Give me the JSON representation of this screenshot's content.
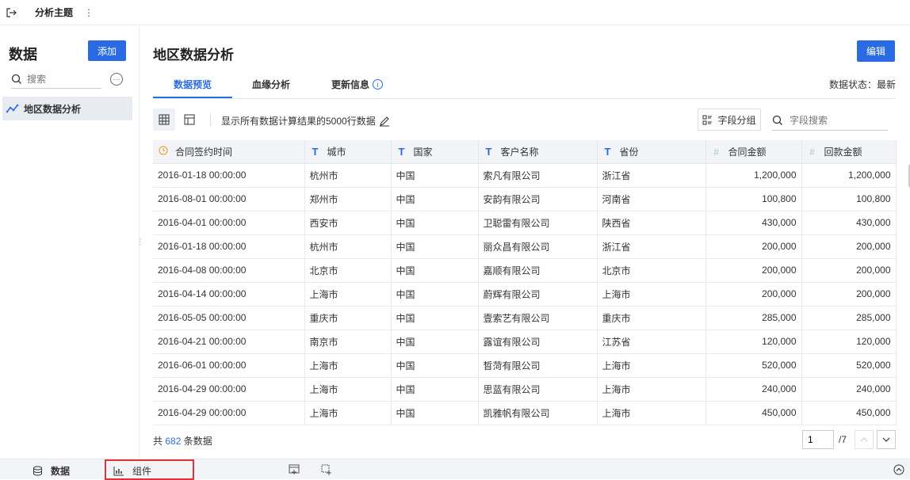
{
  "topbar": {
    "title": "分析主题",
    "more": "⋮"
  },
  "sidebar": {
    "heading": "数据",
    "add_label": "添加",
    "search_placeholder": "搜索",
    "items": [
      {
        "label": "地区数据分析"
      }
    ]
  },
  "main": {
    "title": "地区数据分析",
    "edit_label": "编辑",
    "tabs": [
      {
        "label": "数据预览",
        "active": true
      },
      {
        "label": "血缘分析"
      },
      {
        "label": "更新信息",
        "info_icon": "i"
      }
    ],
    "status": "数据状态：最新",
    "toolbar_text": "显示所有数据计算结果的5000行数据",
    "group_label": "字段分组",
    "field_search_placeholder": "字段搜索"
  },
  "table": {
    "columns": [
      {
        "label": "合同签约时间",
        "icon": "clock-icon"
      },
      {
        "label": "城市",
        "icon": "T"
      },
      {
        "label": "国家",
        "icon": "T"
      },
      {
        "label": "客户名称",
        "icon": "T"
      },
      {
        "label": "省份",
        "icon": "T"
      },
      {
        "label": "合同金额",
        "icon": "#"
      },
      {
        "label": "回款金额",
        "icon": "#"
      }
    ],
    "rows": [
      [
        "2016-01-18 00:00:00",
        "杭州市",
        "中国",
        "索凡有限公司",
        "浙江省",
        "1,200,000",
        "1,200,000"
      ],
      [
        "2016-08-01 00:00:00",
        "郑州市",
        "中国",
        "安韵有限公司",
        "河南省",
        "100,800",
        "100,800"
      ],
      [
        "2016-04-01 00:00:00",
        "西安市",
        "中国",
        "卫聪雷有限公司",
        "陕西省",
        "430,000",
        "430,000"
      ],
      [
        "2016-01-18 00:00:00",
        "杭州市",
        "中国",
        "丽众昌有限公司",
        "浙江省",
        "200,000",
        "200,000"
      ],
      [
        "2016-04-08 00:00:00",
        "北京市",
        "中国",
        "嘉顺有限公司",
        "北京市",
        "200,000",
        "200,000"
      ],
      [
        "2016-04-14 00:00:00",
        "上海市",
        "中国",
        "蔚辉有限公司",
        "上海市",
        "200,000",
        "200,000"
      ],
      [
        "2016-05-05 00:00:00",
        "重庆市",
        "中国",
        "壹索艺有限公司",
        "重庆市",
        "285,000",
        "285,000"
      ],
      [
        "2016-04-21 00:00:00",
        "南京市",
        "中国",
        "露谊有限公司",
        "江苏省",
        "120,000",
        "120,000"
      ],
      [
        "2016-06-01 00:00:00",
        "上海市",
        "中国",
        "晳菏有限公司",
        "上海市",
        "520,000",
        "520,000"
      ],
      [
        "2016-04-29 00:00:00",
        "上海市",
        "中国",
        "思蓝有限公司",
        "上海市",
        "240,000",
        "240,000"
      ],
      [
        "2016-04-29 00:00:00",
        "上海市",
        "中国",
        "凯雅帆有限公司",
        "上海市",
        "450,000",
        "450,000"
      ]
    ]
  },
  "footer": {
    "total_prefix": "共",
    "total_count": "682",
    "total_suffix": "条数据",
    "page_value": "1",
    "page_total": "/7"
  },
  "bottombar": {
    "data_label": "数据",
    "component_label": "组件"
  }
}
